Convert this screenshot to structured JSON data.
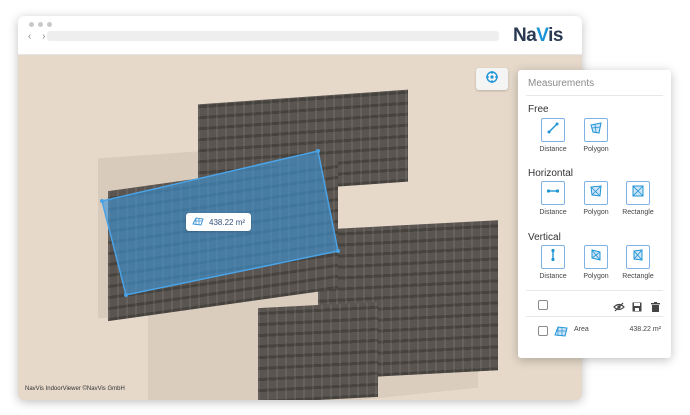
{
  "browser": {
    "logo_prefix": "Na",
    "logo_accent": "V",
    "logo_suffix": "is",
    "back_forward": "‹ ›"
  },
  "map": {
    "measurement_value": "438.22 m²",
    "copyright": "NavVis IndoorViewer ©NavVis GmbH",
    "compass_icon": "compass-icon"
  },
  "panel": {
    "title": "Measurements",
    "sections": [
      {
        "title": "Free",
        "tools": [
          "Distance",
          "Polygon"
        ]
      },
      {
        "title": "Horizontal",
        "tools": [
          "Distance",
          "Polygon",
          "Rectangle"
        ]
      },
      {
        "title": "Vertical",
        "tools": [
          "Distance",
          "Polygon",
          "Rectangle"
        ]
      }
    ],
    "results": [
      {
        "label": "Area",
        "value": "438.22 m²"
      }
    ]
  },
  "colors": {
    "accent": "#1e94d6",
    "selection": "#3d95d6",
    "logo_dark": "#2b3a53"
  }
}
